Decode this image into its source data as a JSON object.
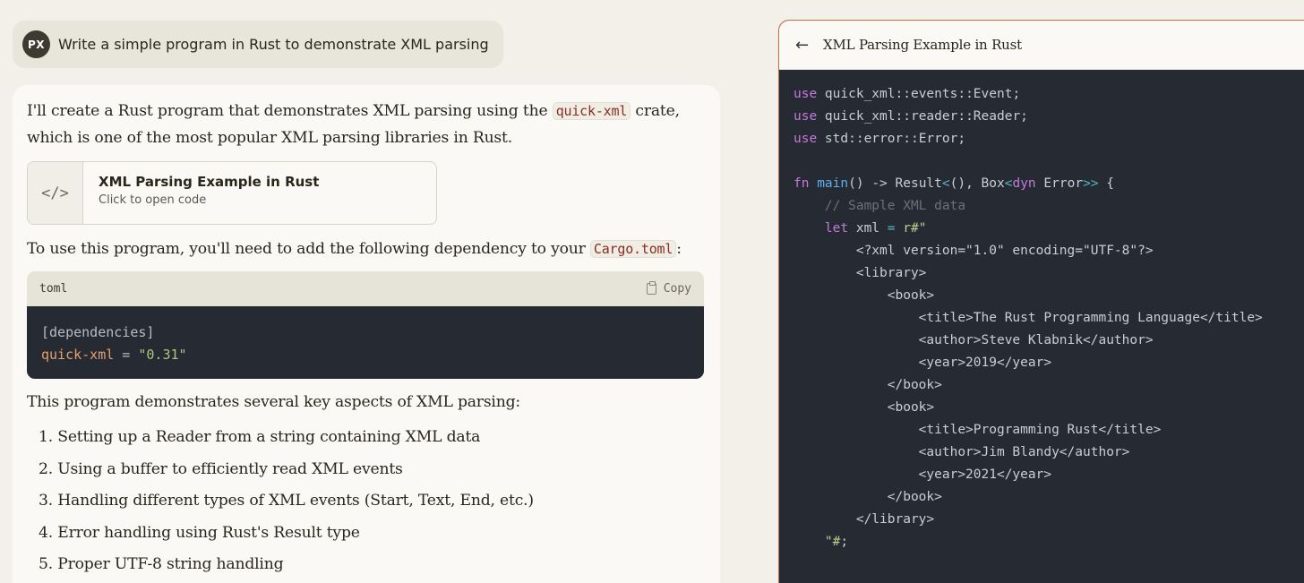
{
  "user_message": {
    "avatar_initials": "PX",
    "text": "Write a simple program in Rust to demonstrate XML parsing"
  },
  "assistant": {
    "intro_before": "I'll create a Rust program that demonstrates XML parsing using the ",
    "intro_code": "quick-xml",
    "intro_after": " crate, which is one of the most popular XML parsing libraries in Rust.",
    "artifact_card": {
      "icon": "code-icon",
      "icon_glyph": "</>",
      "title": "XML Parsing Example in Rust",
      "subtitle": "Click to open code"
    },
    "dep_before": "To use this program, you'll need to add the following dependency to your ",
    "dep_code": "Cargo.toml",
    "dep_after": ":",
    "code_block": {
      "language": "toml",
      "copy_label": "Copy",
      "line1": "[dependencies]",
      "line2_key": "quick-xml",
      "line2_eq": " = ",
      "line2_value": "\"0.31\""
    },
    "aspects_intro": "This program demonstrates several key aspects of XML parsing:",
    "aspects": [
      "1. Setting up a Reader from a string containing XML data",
      "2. Using a buffer to efficiently read XML events",
      "3. Handling different types of XML events (Start, Text, End, etc.)",
      "4. Error handling using Rust's Result type",
      "5. Proper UTF-8 string handling"
    ]
  },
  "artifact_panel": {
    "back_icon": "arrow-left-icon",
    "title": "XML Parsing Example in Rust",
    "code": {
      "l1_kw": "use",
      "l1_rest": " quick_xml::events::Event;",
      "l2_kw": "use",
      "l2_rest": " quick_xml::reader::Reader;",
      "l3_kw": "use",
      "l3_rest": " std::error::Error;",
      "l5_fn": "fn",
      "l5_name": " main",
      "l5_a": "() -> Result",
      "l5_lt": "<",
      "l5_b": "(), Box",
      "l5_lt2": "<",
      "l5_dyn": "dyn",
      "l5_c": " Error",
      "l5_gt": ">>",
      "l5_d": " {",
      "l6_comment": "    // Sample XML data",
      "l7_let": "    let",
      "l7_rest": " xml ",
      "l7_eq": "=",
      "l7_str": " r#\"",
      "l8": "        <?xml version=\"1.0\" encoding=\"UTF-8\"?>",
      "l9": "        <library>",
      "l10": "            <book>",
      "l11": "                <title>The Rust Programming Language</title>",
      "l12": "                <author>Steve Klabnik</author>",
      "l13": "                <year>2019</year>",
      "l14": "            </book>",
      "l15": "            <book>",
      "l16": "                <title>Programming Rust</title>",
      "l17": "                <author>Jim Blandy</author>",
      "l18": "                <year>2021</year>",
      "l19": "            </book>",
      "l20": "        </library>",
      "l21_str": "    \"#",
      "l21_end": ";"
    }
  }
}
